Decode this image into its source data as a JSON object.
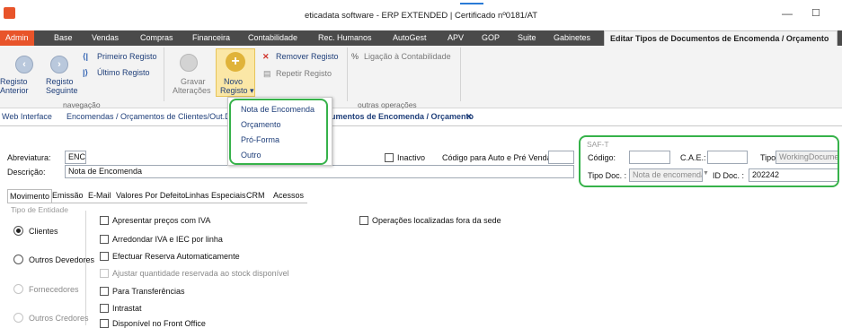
{
  "window": {
    "title": "eticadata software - ERP EXTENDED | Certificado nº0181/AT",
    "minimize_glyph": "—",
    "maximize_glyph": "☐"
  },
  "ribbon_tabs": [
    "Admin",
    "Base",
    "Vendas",
    "Compras",
    "Financeira",
    "Contabilidade",
    "Rec. Humanos",
    "AutoGest",
    "APV",
    "GOP",
    "Suite",
    "Gabinetes",
    "Editar Tipos de Documentos de Encomenda / Orçamento"
  ],
  "ribbon": {
    "registo_anterior": "Registo Anterior",
    "registo_anterior_l1": "Registo",
    "registo_anterior_l2": "Anterior",
    "registo_seguinte_l1": "Registo",
    "registo_seguinte_l2": "Seguinte",
    "primeiro_registo": "Primeiro Registo",
    "ultimo_registo": "Último Registo",
    "navegacao": "navegação",
    "gravar_l1": "Gravar",
    "gravar_l2": "Alterações",
    "novo_l1": "Novo",
    "novo_l2": "Registo ▾",
    "remover_registo": "Remover Registo",
    "repetir_registo": "Repetir Registo",
    "ligacao_contabilidade": "Ligação à Contabilidade",
    "outras_operacoes": "outras operações"
  },
  "novo_menu": [
    "Nota de Encomenda",
    "Orçamento",
    "Pró-Forma",
    "Outro"
  ],
  "doc_tabs": {
    "web_interface": "Web Interface",
    "encomendas": "Encomendas / Orçamentos de Clientes/Out.De",
    "editar": "umentos de Encomenda / Orçamento",
    "close": "✕"
  },
  "form": {
    "abreviatura_label": "Abreviatura:",
    "abreviatura_value": "ENC",
    "descricao_label": "Descrição:",
    "descricao_value": "Nota de Encomenda",
    "inactivo_label": "Inactivo",
    "codigo_auto_label": "Código para Auto e Pré Venda:",
    "codigo_auto_value": ""
  },
  "saft": {
    "title": "SAF-T",
    "codigo_label": "Código:",
    "cae_label": "C.A.E.:",
    "tipo_label": "Tipo:",
    "tipo_value": "WorkingDocumer",
    "tipo_doc_label": "Tipo Doc. :",
    "tipo_doc_value": "Nota de encomenda",
    "id_doc_label": "ID Doc. :",
    "id_doc_value": "202242"
  },
  "form_tabs": [
    "Movimento",
    "Emissão",
    "E-Mail",
    "Valores Por Defeito",
    "Linhas Especiais",
    "CRM",
    "Acessos"
  ],
  "entidade": {
    "title": "Tipo de Entidade",
    "options": [
      "Clientes",
      "Outros Devedores",
      "Fornecedores",
      "Outros Credores"
    ]
  },
  "checkboxes": [
    "Apresentar preços com IVA",
    "Arredondar IVA e IEC por linha",
    "Efectuar Reserva Automaticamente",
    "Ajustar quantidade reservada ao stock disponível",
    "Para Transferências",
    "Intrastat",
    "Disponível no Front Office"
  ],
  "checkbox_right": "Operações localizadas fora da sede",
  "colors": {
    "accent": "#e8542a",
    "highlight": "#36b24a",
    "tab_bar": "#4a4a4a"
  }
}
